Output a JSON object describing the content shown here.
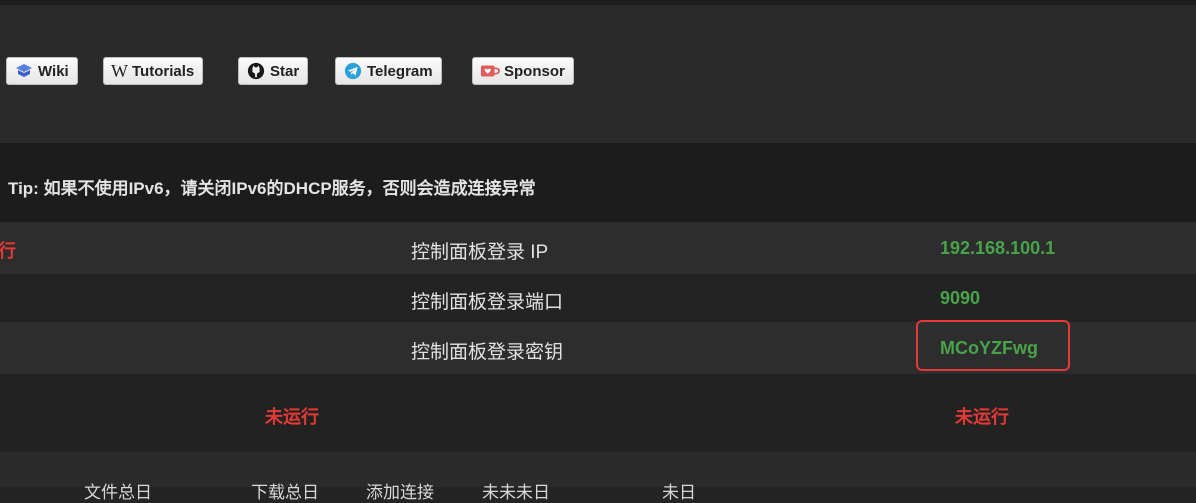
{
  "badges": {
    "wiki": "Wiki",
    "tutorials": "Tutorials",
    "star": "Star",
    "telegram": "Telegram",
    "sponsor": "Sponsor"
  },
  "tip": "Tip: 如果不使用IPv6，请关闭IPv6的DHCP服务，否则会造成连接异常",
  "status_partial": "行",
  "info": {
    "ip_label": "控制面板登录 IP",
    "ip_value": "192.168.100.1",
    "port_label": "控制面板登录端口",
    "port_value": "9090",
    "key_label": "控制面板登录密钥",
    "key_value": "MCoYZFwg"
  },
  "status": {
    "left": "未运行",
    "right": "未运行"
  },
  "bottom_partial": [
    "文件总日",
    "下载总日",
    "添加连接",
    "未未未日",
    "未日"
  ],
  "colors": {
    "green": "#49a34a",
    "red": "#e53935",
    "telegram": "#2aa1da",
    "sponsor": "#e05d5d",
    "wiki": "#5a7de0"
  },
  "icons": [
    "book-icon",
    "wikipedia-icon",
    "github-icon",
    "telegram-icon",
    "kofi-cup-icon"
  ]
}
